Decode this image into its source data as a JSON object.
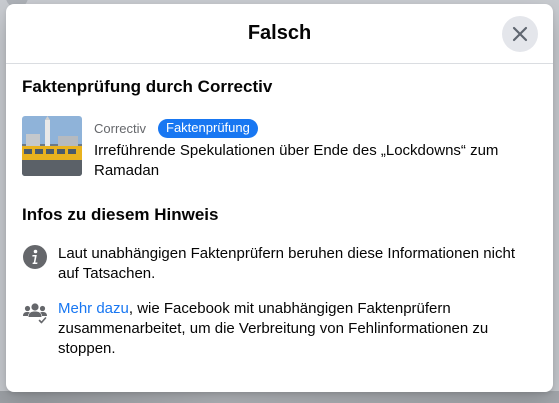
{
  "dialog": {
    "title": "Falsch"
  },
  "factcheck": {
    "section_title": "Faktenprüfung durch Correctiv",
    "publisher": "Correctiv",
    "badge": "Faktenprüfung",
    "article_title": "Irreführende Spekulationen über Ende des „Lockdowns“ zum Ramadan"
  },
  "info": {
    "section_title": "Infos zu diesem Hinweis",
    "item1_text": "Laut unabhängigen Faktenprüfern beruhen diese Informationen nicht auf Tatsachen.",
    "item2_link": "Mehr dazu",
    "item2_text": ", wie Facebook mit unabhängigen Faktenprüfern zusammenarbeitet, um die Verbreitung von Fehlinformationen zu stoppen."
  },
  "icons": {
    "close": "close-icon",
    "info": "info-icon",
    "people": "people-icon"
  },
  "colors": {
    "accent": "#1877f2",
    "close_bg": "#e4e6eb",
    "icon": "#65676b"
  }
}
